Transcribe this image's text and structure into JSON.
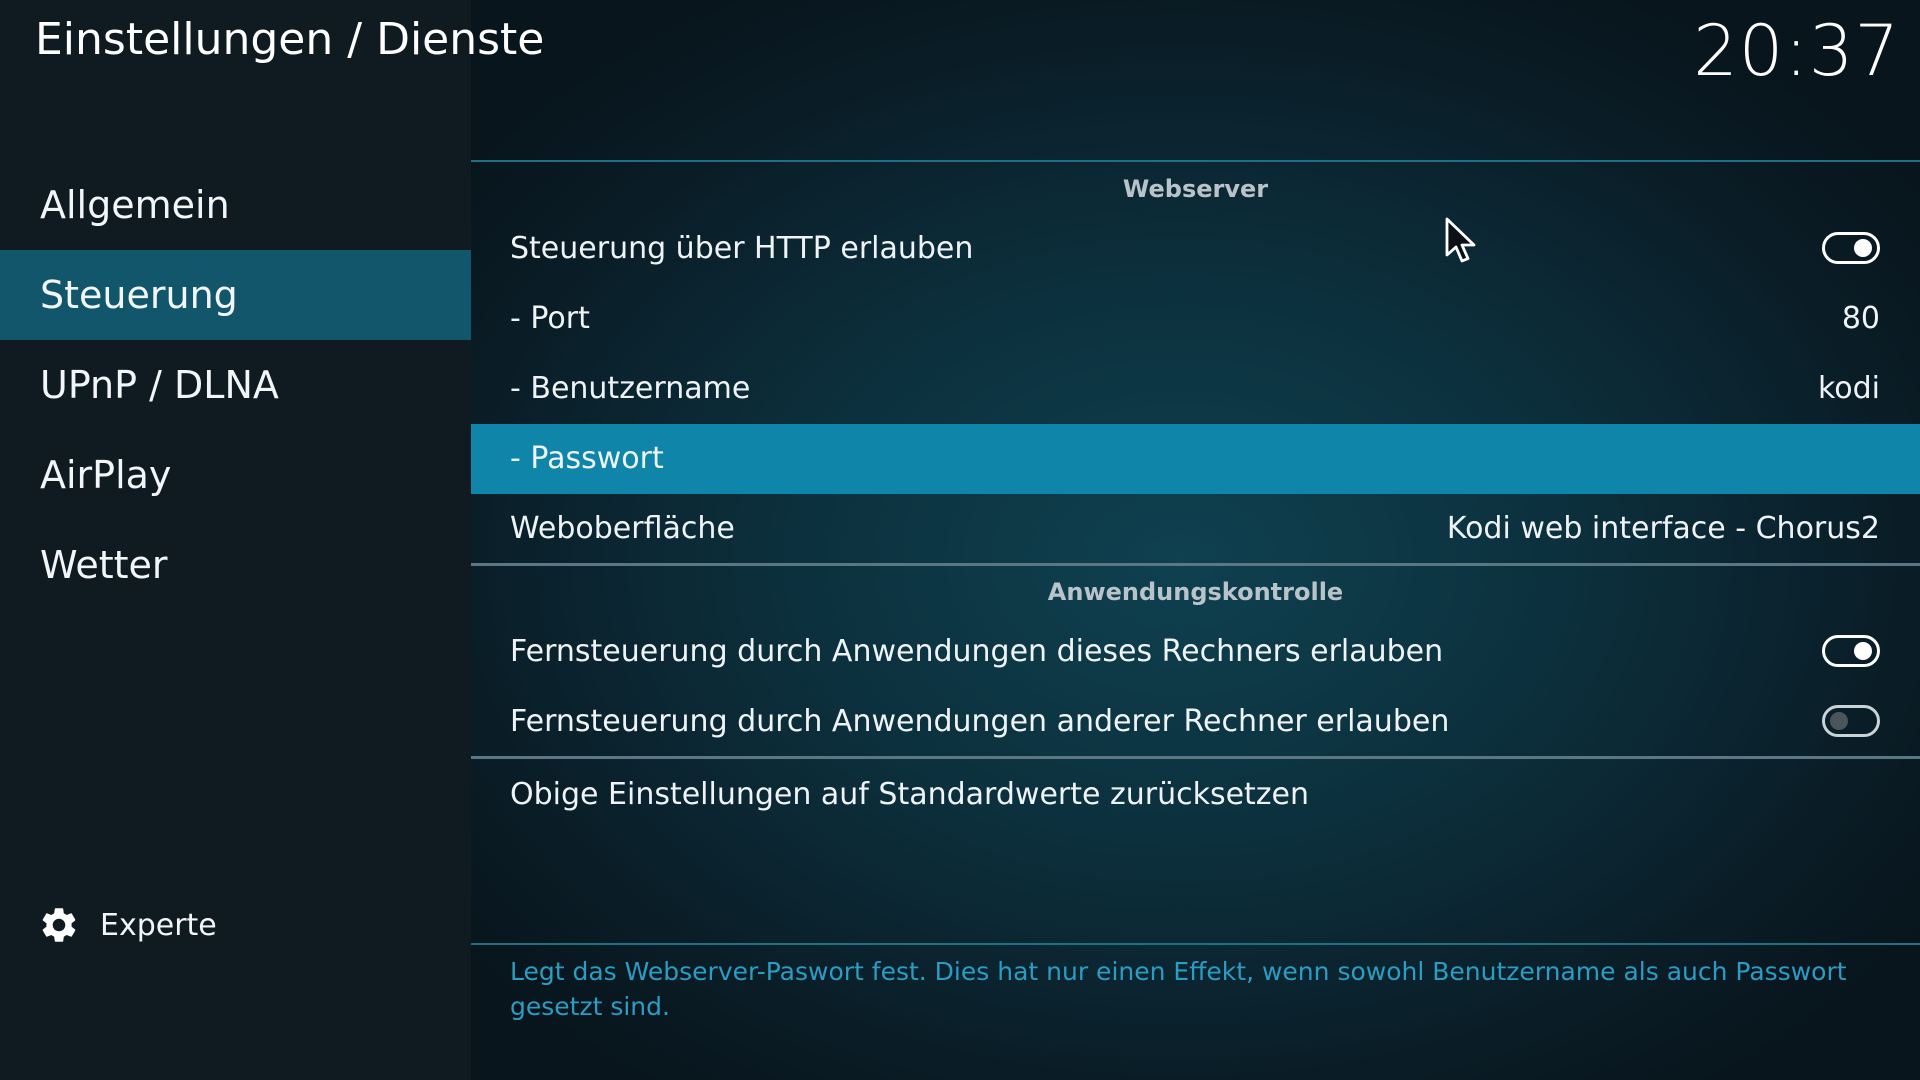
{
  "header": {
    "title": "Einstellungen / Dienste",
    "clock": "20:37"
  },
  "sidebar": {
    "items": [
      {
        "label": "Allgemein"
      },
      {
        "label": "Steuerung"
      },
      {
        "label": "UPnP / DLNA"
      },
      {
        "label": "AirPlay"
      },
      {
        "label": "Wetter"
      }
    ],
    "active_index": 1,
    "expert_label": "Experte"
  },
  "groups": {
    "webserver": {
      "title": "Webserver",
      "allow_http_label": "Steuerung über HTTP erlauben",
      "allow_http_state": "on",
      "port_label": "- Port",
      "port_value": "80",
      "username_label": "- Benutzername",
      "username_value": "kodi",
      "password_label": "- Passwort",
      "password_value": "",
      "web_interface_label": "Weboberfläche",
      "web_interface_value": "Kodi web interface - Chorus2"
    },
    "app_control": {
      "title": "Anwendungskontrolle",
      "local_label": "Fernsteuerung durch Anwendungen dieses Rechners erlauben",
      "local_state": "on",
      "remote_label": "Fernsteuerung durch Anwendungen anderer Rechner erlauben",
      "remote_state": "off"
    },
    "reset_label": "Obige Einstellungen auf Standardwerte zurücksetzen"
  },
  "description": "Legt das Webserver-Paswort fest. Dies hat nur einen Effekt, wenn sowohl Benutzername als auch Passwort gesetzt sind.",
  "colors": {
    "accent_focus": "#0f86a9",
    "sidebar_active": "#12566b",
    "description_text": "#2d9bc2"
  }
}
